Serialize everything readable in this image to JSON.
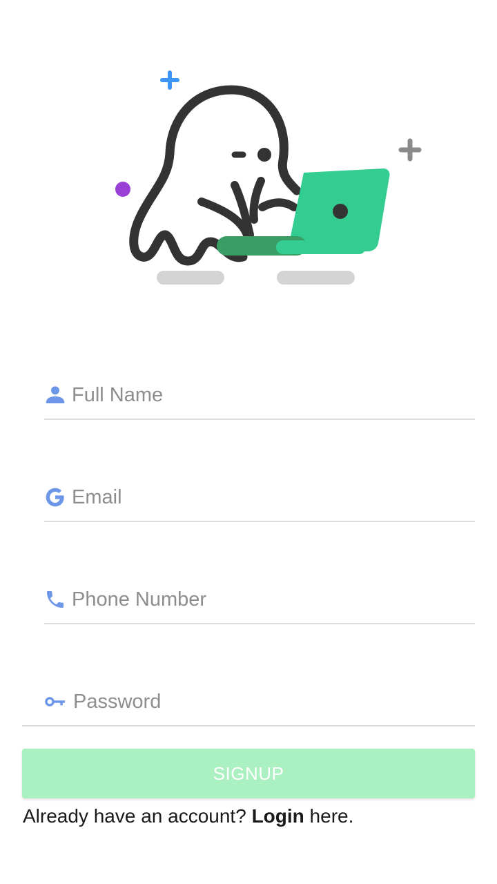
{
  "illustration": {
    "name": "ghost-with-laptop",
    "colors": {
      "outline": "#333333",
      "laptop": "#33cc91",
      "laptop_base": "#3a9e64",
      "sparkle_blue": "#3d95f5",
      "sparkle_gray": "#8a8a8a",
      "dot_purple": "#9b40d6",
      "shadow": "#d4d4d4"
    }
  },
  "form": {
    "full_name": {
      "placeholder": "Full Name",
      "value": "",
      "icon": "person-icon"
    },
    "email": {
      "placeholder": "Email",
      "value": "",
      "icon": "google-icon"
    },
    "phone": {
      "placeholder": "Phone Number",
      "value": "",
      "icon": "phone-icon"
    },
    "password": {
      "placeholder": "Password",
      "value": "",
      "icon": "key-icon"
    },
    "icon_color": "#6d96e8",
    "signup_label": "SIGNUP",
    "signup_color": "#abf0c0"
  },
  "footer": {
    "prefix": "Already have an account? ",
    "login_link": "Login",
    "suffix": " here."
  }
}
